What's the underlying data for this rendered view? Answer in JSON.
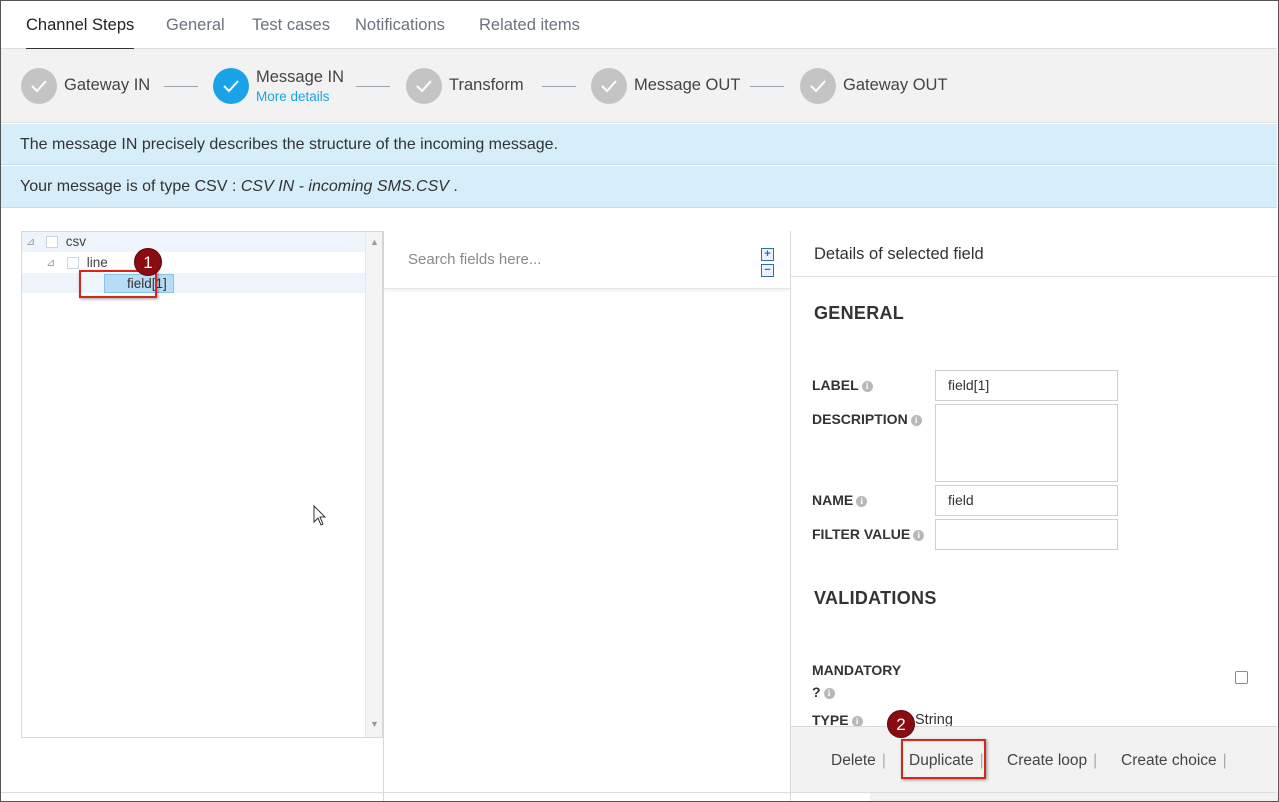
{
  "tabs": [
    {
      "label": "Channel Steps",
      "active": true
    },
    {
      "label": "General"
    },
    {
      "label": "Test cases"
    },
    {
      "label": "Notifications"
    },
    {
      "label": "Related items"
    }
  ],
  "steps": [
    {
      "label": "Gateway IN"
    },
    {
      "label": "Message IN",
      "sub": "More details",
      "current": true
    },
    {
      "label": "Transform"
    },
    {
      "label": "Message OUT"
    },
    {
      "label": "Gateway OUT"
    }
  ],
  "banner": {
    "line1": "The message IN precisely describes the structure of the incoming message.",
    "line2_prefix": "Your message is of type CSV : ",
    "line2_type": "CSV IN - incoming SMS.CSV",
    "line2_suffix": " ."
  },
  "tree": {
    "root": "csv",
    "child": "line",
    "leaf": "field[1]"
  },
  "search": {
    "placeholder": "Search fields here...",
    "expand": "+",
    "collapse": "−"
  },
  "details": {
    "header": "Details of selected field",
    "general_title": "GENERAL",
    "label_label": "LABEL",
    "label_value": "field[1]",
    "description_label": "DESCRIPTION",
    "description_value": "",
    "name_label": "NAME",
    "name_value": "field",
    "filter_label": "FILTER VALUE",
    "filter_value": "",
    "validations_title": "VALIDATIONS",
    "mandatory_label_1": "MANDATORY",
    "mandatory_label_2": "?",
    "type_label": "TYPE",
    "type_value": "String"
  },
  "footer": {
    "delete": "Delete",
    "duplicate": "Duplicate",
    "create_loop": "Create loop",
    "create_choice": "Create choice",
    "separator": "|"
  },
  "annotations": {
    "badge1": "1",
    "badge2": "2"
  },
  "colors": {
    "accent": "#1aa3e8",
    "banner": "#d6eef9",
    "highlight": "#d9261c",
    "badge": "#8b0b12"
  }
}
